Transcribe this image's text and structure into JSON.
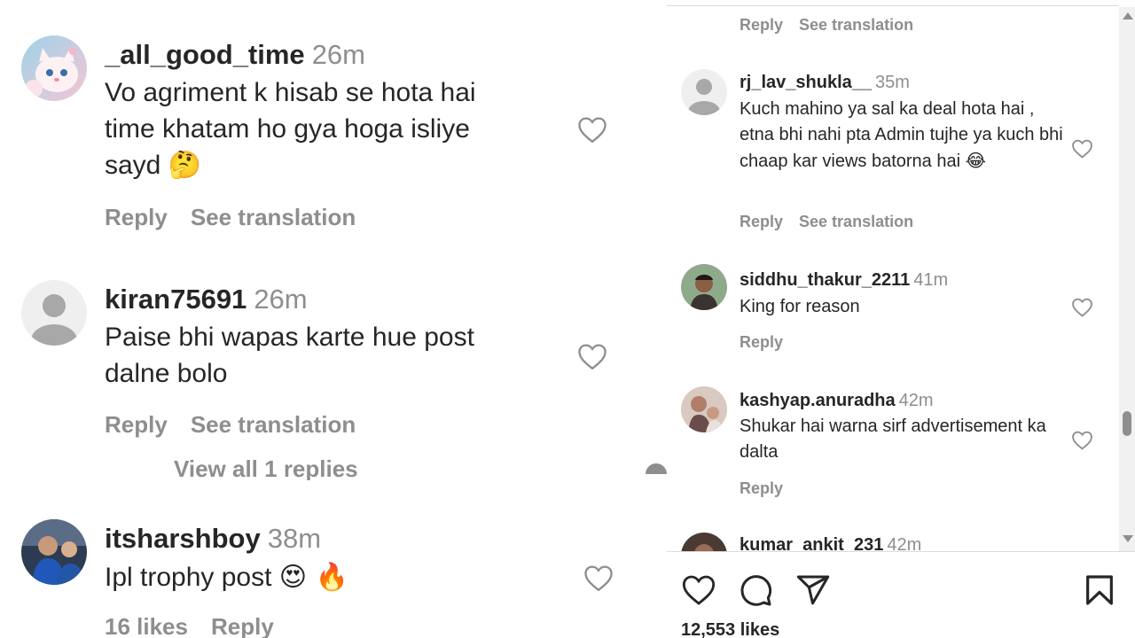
{
  "left_panel": {
    "comments": [
      {
        "username": "_all_good_time",
        "time": "26m",
        "text": "Vo agriment k hisab se hota hai time khatam ho gya hoga isliye sayd",
        "emoji": "🤔",
        "reply": "Reply",
        "translate": "See translation"
      },
      {
        "username": "kiran75691",
        "time": "26m",
        "text": "Paise bhi wapas karte hue post dalne bolo",
        "reply": "Reply",
        "translate": "See translation"
      },
      {
        "username": "itsharshboy",
        "time": "38m",
        "text": "Ipl trophy post",
        "emoji": "😍 🔥",
        "likes": "16 likes",
        "reply": "Reply"
      }
    ],
    "view_all_replies": "View all 1 replies"
  },
  "right_panel": {
    "top_reply": "Reply",
    "top_translate": "See translation",
    "comments": [
      {
        "username": "rj_lav_shukla__",
        "time": "35m",
        "text": "Kuch mahino ya sal ka deal hota hai , etna bhi nahi pta Admin tujhe ya kuch bhi chaap kar views batorna hai",
        "emoji": "😂",
        "reply": "Reply",
        "translate": "See translation"
      },
      {
        "username": "siddhu_thakur_2211",
        "time": "41m",
        "text": "King for reason",
        "reply": "Reply"
      },
      {
        "username": "kashyap.anuradha",
        "time": "42m",
        "text": "Shukar hai warna sirf advertisement ka dalta",
        "reply": "Reply"
      },
      {
        "username": "kumar_ankit_231",
        "time": "42m"
      }
    ],
    "likes_count": "12,553 likes"
  },
  "icons": {
    "heart": "heart-icon",
    "comment": "comment-icon",
    "share": "share-icon",
    "bookmark": "bookmark-icon"
  },
  "colors": {
    "text": "#262626",
    "muted": "#8e8e8e",
    "divider": "#dbdbdb"
  }
}
